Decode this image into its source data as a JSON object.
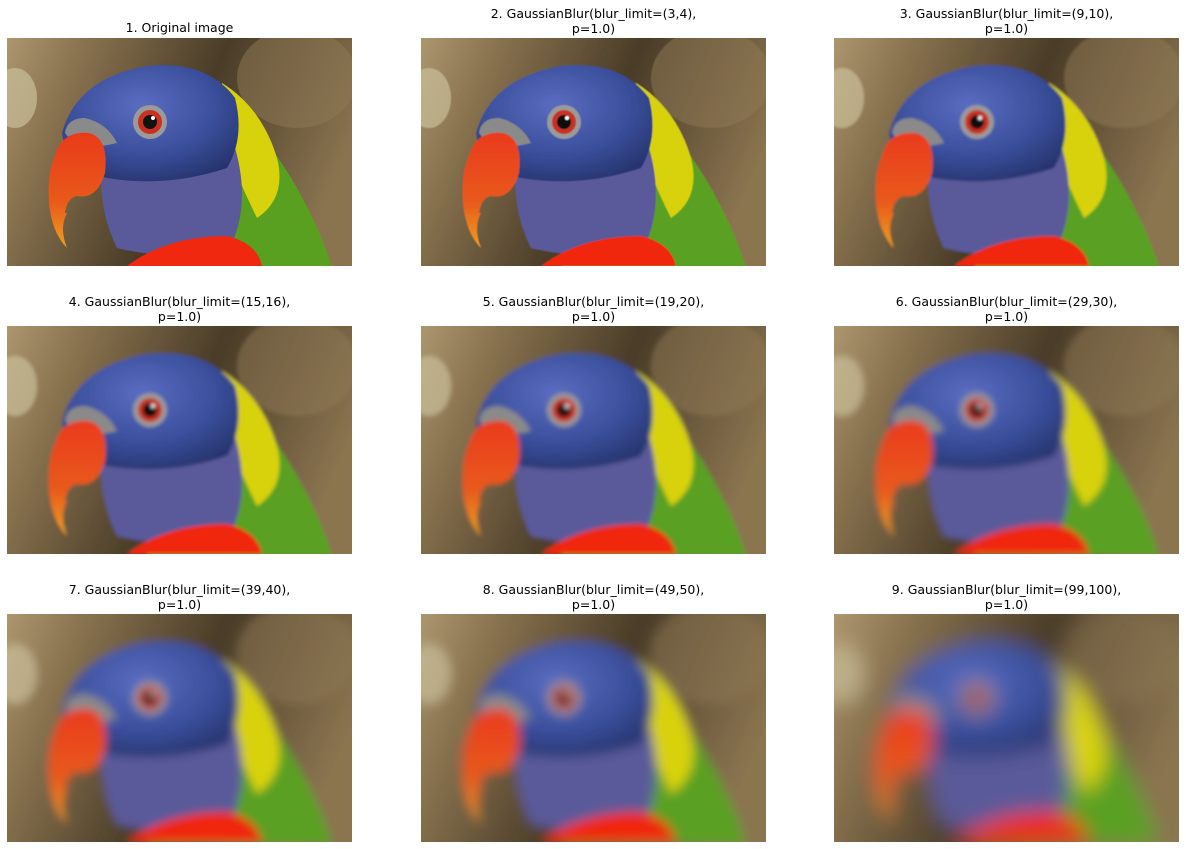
{
  "figure": {
    "panels": [
      {
        "title": "1. Original image",
        "blur": 0
      },
      {
        "title": "2. GaussianBlur(blur_limit=(3,4),\np=1.0)",
        "blur": 0.6
      },
      {
        "title": "3. GaussianBlur(blur_limit=(9,10),\np=1.0)",
        "blur": 1.2
      },
      {
        "title": "4. GaussianBlur(blur_limit=(15,16),\np=1.0)",
        "blur": 1.9
      },
      {
        "title": "5. GaussianBlur(blur_limit=(19,20),\np=1.0)",
        "blur": 2.4
      },
      {
        "title": "6. GaussianBlur(blur_limit=(29,30),\np=1.0)",
        "blur": 3.4
      },
      {
        "title": "7. GaussianBlur(blur_limit=(39,40),\np=1.0)",
        "blur": 4.4
      },
      {
        "title": "8. GaussianBlur(blur_limit=(49,50),\np=1.0)",
        "blur": 5.5
      },
      {
        "title": "9. GaussianBlur(blur_limit=(99,100),\np=1.0)",
        "blur": 10
      }
    ]
  },
  "colors": {
    "background_dark": "#4a3c28",
    "background_mid": "#8a7450",
    "background_light": "#b9a37a",
    "blue_head": "#3a4f9c",
    "purple_neck": "#5a5a9a",
    "green": "#5aa020",
    "yellow": "#d8d20c",
    "red_beak": "#ea3a1a",
    "orange_beak_tip": "#f0a020",
    "chest_red": "#f02810",
    "eye_ring": "#c83020"
  }
}
